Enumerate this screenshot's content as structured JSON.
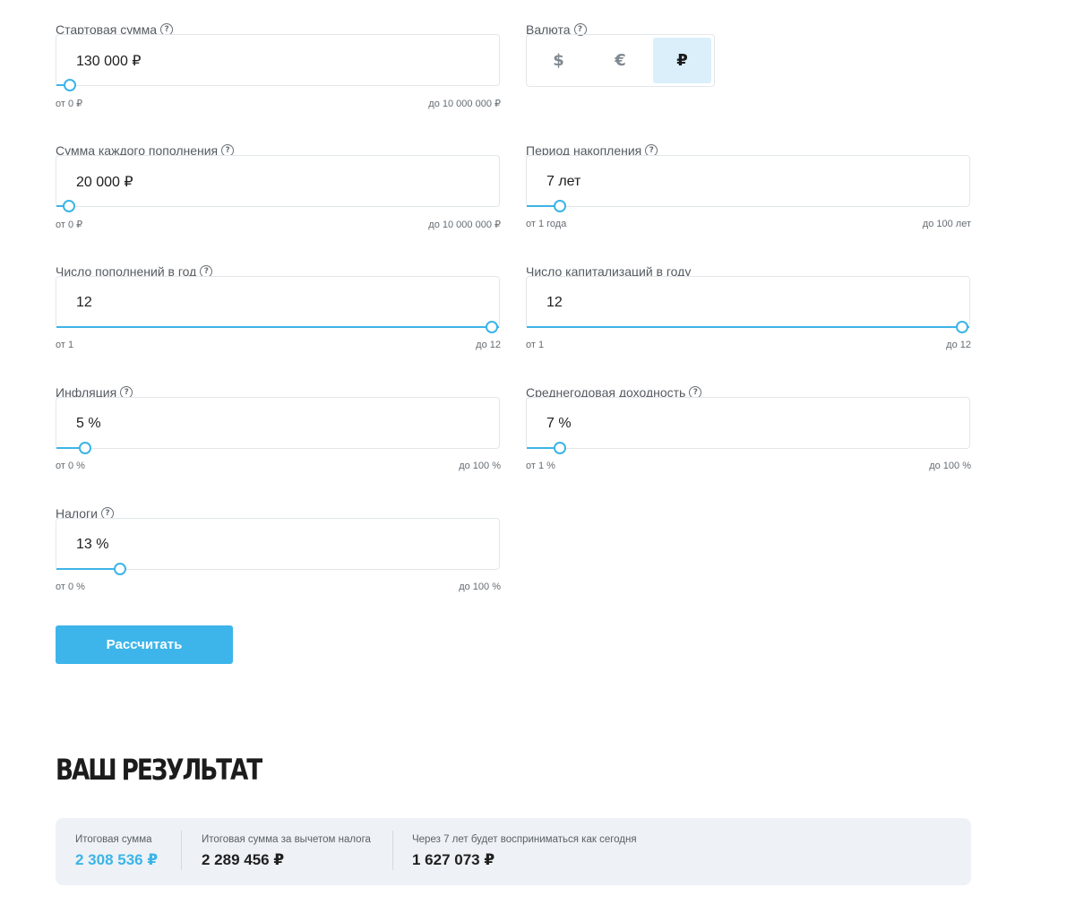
{
  "fields": [
    {
      "id": "start-amount",
      "label": "Стартовая сумма",
      "value": "130 000 ₽",
      "min_label": "от 0 ₽",
      "max_label": "до 10 000 000 ₽",
      "slider_fraction": 0.03
    },
    {
      "id": "deposit-amount",
      "label": "Сумма каждого пополнения",
      "value": "20 000 ₽",
      "min_label": "от 0 ₽",
      "max_label": "до 10 000 000 ₽",
      "slider_fraction": 0.018
    },
    {
      "id": "period",
      "label": "Период накопления",
      "value": "7 лет",
      "min_label": "от 1 года",
      "max_label": "до 100 лет",
      "slider_fraction": 0.075
    },
    {
      "id": "deposits-per-year",
      "label": "Число пополнений в год",
      "value": "12",
      "min_label": "от 1",
      "max_label": "до 12",
      "slider_fraction": 1.0
    },
    {
      "id": "capitalizations",
      "label": "Число капитализаций в году",
      "value": "12",
      "min_label": "от 1",
      "max_label": "до 12",
      "slider_fraction": 1.0
    },
    {
      "id": "inflation",
      "label": "Инфляция",
      "value": "5 %",
      "min_label": "от 0 %",
      "max_label": "до 100 %",
      "slider_fraction": 0.065
    },
    {
      "id": "yield",
      "label": "Среднегодовая доходность",
      "value": "7 %",
      "min_label": "от 1 %",
      "max_label": "до 100 %",
      "slider_fraction": 0.075
    },
    {
      "id": "taxes",
      "label": "Налоги",
      "value": "13 %",
      "min_label": "от 0 %",
      "max_label": "до 100 %",
      "slider_fraction": 0.143
    }
  ],
  "currency": {
    "label": "Валюта",
    "options": [
      "$",
      "€",
      "₽"
    ],
    "selected": "₽"
  },
  "help_icon": "?",
  "calculate_label": "Рассчитать",
  "result": {
    "title": "ВАШ РЕЗУЛЬТАТ",
    "items": [
      {
        "label": "Итоговая сумма",
        "value": "2 308 536 ₽"
      },
      {
        "label": "Итоговая сумма за вычетом налога",
        "value": "2 289 456 ₽"
      },
      {
        "label": "Через 7 лет будет восприниматься как сегодня",
        "value": "1 627 073 ₽"
      }
    ]
  },
  "colors": {
    "accent": "#3cb4e7",
    "selected_bg": "#dbeffb",
    "panel_bg": "#eef2f6"
  }
}
